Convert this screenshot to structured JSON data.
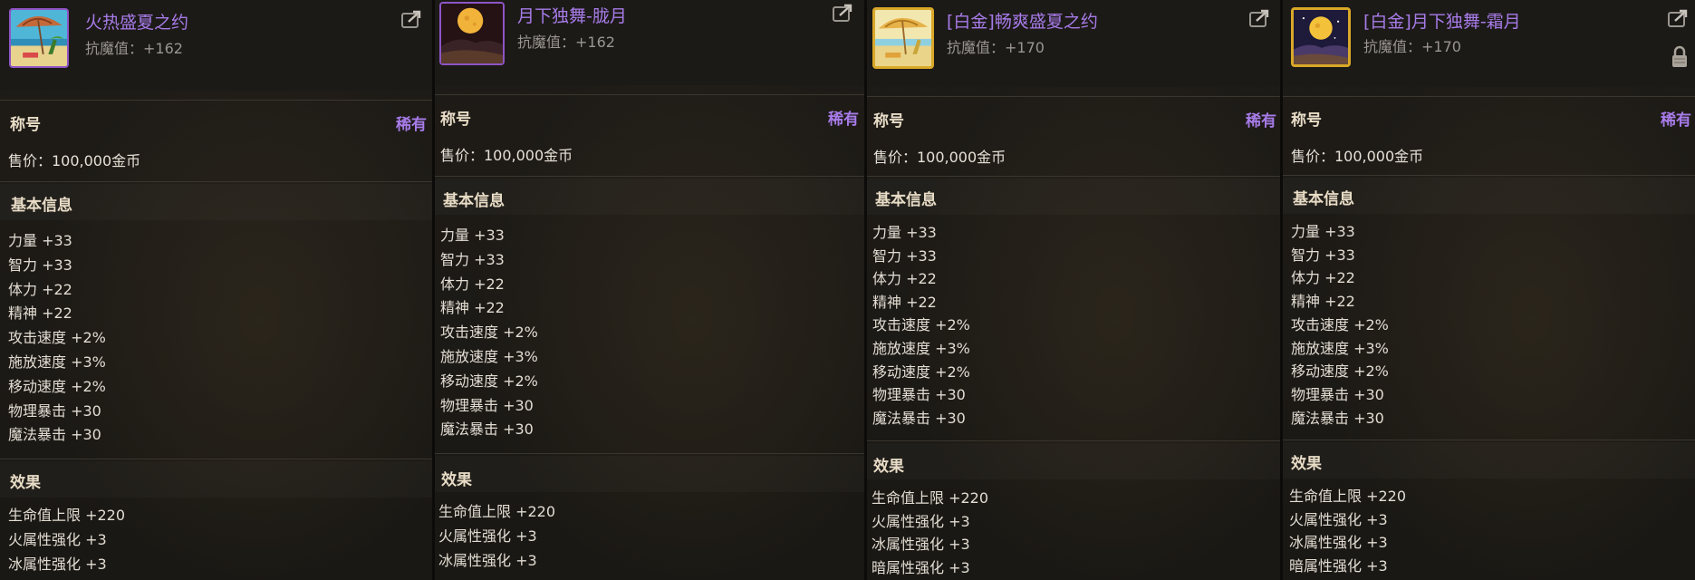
{
  "panels": [
    {
      "name": "火热盛夏之约",
      "magic_resist": "抗魔值：+162",
      "type": "称号",
      "rarity": "稀有",
      "price": "售价：100,000金币",
      "basic_title": "基本信息",
      "stats": [
        "力量 +33",
        "智力 +33",
        "体力 +22",
        "精神 +22",
        "攻击速度 +2%",
        "施放速度 +3%",
        "移动速度 +2%",
        "物理暴击 +30",
        "魔法暴击 +30"
      ],
      "effect_title": "效果",
      "effects": [
        "生命值上限 +220",
        "火属性强化 +3",
        "冰属性强化 +3"
      ],
      "icon": "beach-umbrella-icon",
      "frame_color": "#8e55c6"
    },
    {
      "name": "月下独舞-胧月",
      "magic_resist": "抗魔值：+162",
      "type": "称号",
      "rarity": "稀有",
      "price": "售价：100,000金币",
      "basic_title": "基本信息",
      "stats": [
        "力量 +33",
        "智力 +33",
        "体力 +22",
        "精神 +22",
        "攻击速度 +2%",
        "施放速度 +3%",
        "移动速度 +2%",
        "物理暴击 +30",
        "魔法暴击 +30"
      ],
      "effect_title": "效果",
      "effects": [
        "生命值上限 +220",
        "火属性强化 +3",
        "冰属性强化 +3"
      ],
      "icon": "moon-night-icon",
      "frame_color": "#8e55c6"
    },
    {
      "name": "[白金]畅爽盛夏之约",
      "magic_resist": "抗魔值：+170",
      "type": "称号",
      "rarity": "稀有",
      "price": "售价：100,000金币",
      "basic_title": "基本信息",
      "stats": [
        "力量 +33",
        "智力 +33",
        "体力 +22",
        "精神 +22",
        "攻击速度 +2%",
        "施放速度 +3%",
        "移动速度 +2%",
        "物理暴击 +30",
        "魔法暴击 +30"
      ],
      "effect_title": "效果",
      "effects": [
        "生命值上限 +220",
        "火属性强化 +3",
        "冰属性强化 +3",
        "暗属性强化 +3"
      ],
      "icon": "beach-umbrella-icon",
      "frame_color": "#d9a828"
    },
    {
      "name": "[白金]月下独舞-霜月",
      "magic_resist": "抗魔值：+170",
      "type": "称号",
      "rarity": "稀有",
      "price": "售价：100,000金币",
      "basic_title": "基本信息",
      "stats": [
        "力量 +33",
        "智力 +33",
        "体力 +22",
        "精神 +22",
        "攻击速度 +2%",
        "施放速度 +3%",
        "移动速度 +2%",
        "物理暴击 +30",
        "魔法暴击 +30"
      ],
      "effect_title": "效果",
      "effects": [
        "生命值上限 +220",
        "火属性强化 +3",
        "冰属性强化 +3",
        "暗属性强化 +3"
      ],
      "icon": "moon-night-icon",
      "frame_color": "#d9a828"
    }
  ]
}
